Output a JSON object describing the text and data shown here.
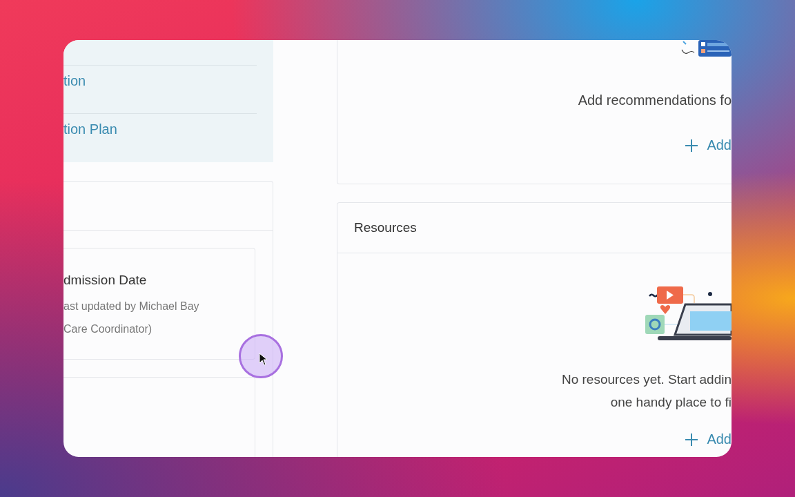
{
  "sidebar": {
    "items": [
      {
        "label": "tion"
      },
      {
        "label": "tion Plan"
      }
    ]
  },
  "details_card": {
    "entry": {
      "title": "dmission Date",
      "meta": [
        "ast updated by Michael Bay",
        "Care Coordinator)"
      ]
    }
  },
  "recommendations_card": {
    "message": "Add recommendations fo",
    "add_button": "Add"
  },
  "resources_card": {
    "title": "Resources",
    "message": [
      "No resources yet. Start addin",
      "one handy place to fi"
    ],
    "add_button": "Add"
  }
}
